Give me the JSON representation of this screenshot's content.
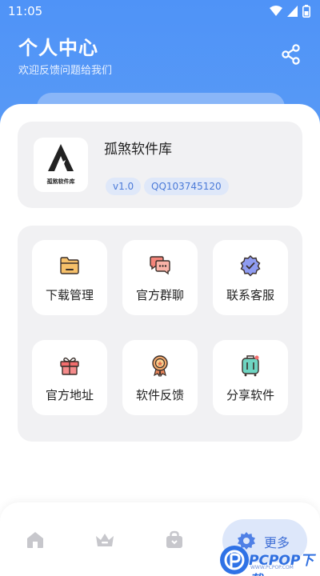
{
  "status_bar": {
    "time": "11:05"
  },
  "header": {
    "title": "个人中心",
    "subtitle": "欢迎反馈问题给我们",
    "share_icon": "share-icon"
  },
  "profile": {
    "logo_text": "孤煞软件库",
    "app_name": "孤煞软件库",
    "version": "v1.0",
    "qq": "QQ103745120"
  },
  "menu": {
    "items": [
      {
        "label": "下载管理",
        "icon": "folder-icon"
      },
      {
        "label": "官方群聊",
        "icon": "chat-bubbles-icon"
      },
      {
        "label": "联系客服",
        "icon": "verified-badge-icon"
      },
      {
        "label": "官方地址",
        "icon": "gift-icon"
      },
      {
        "label": "软件反馈",
        "icon": "medal-icon"
      },
      {
        "label": "分享软件",
        "icon": "luggage-icon"
      }
    ]
  },
  "tabbar": {
    "tabs": [
      {
        "icon": "home-icon"
      },
      {
        "icon": "crown-icon"
      },
      {
        "icon": "bag-icon"
      },
      {
        "icon": "gear-icon",
        "label": "更多",
        "active": true
      }
    ]
  },
  "watermark": {
    "text": "PCPOP下载",
    "sub": "WWW.PCPOP.COM"
  },
  "colors": {
    "primary": "#4f93f7",
    "accent": "#3f6fd6",
    "panel": "#f1f1f3",
    "badge_bg": "#dfe8f9"
  }
}
